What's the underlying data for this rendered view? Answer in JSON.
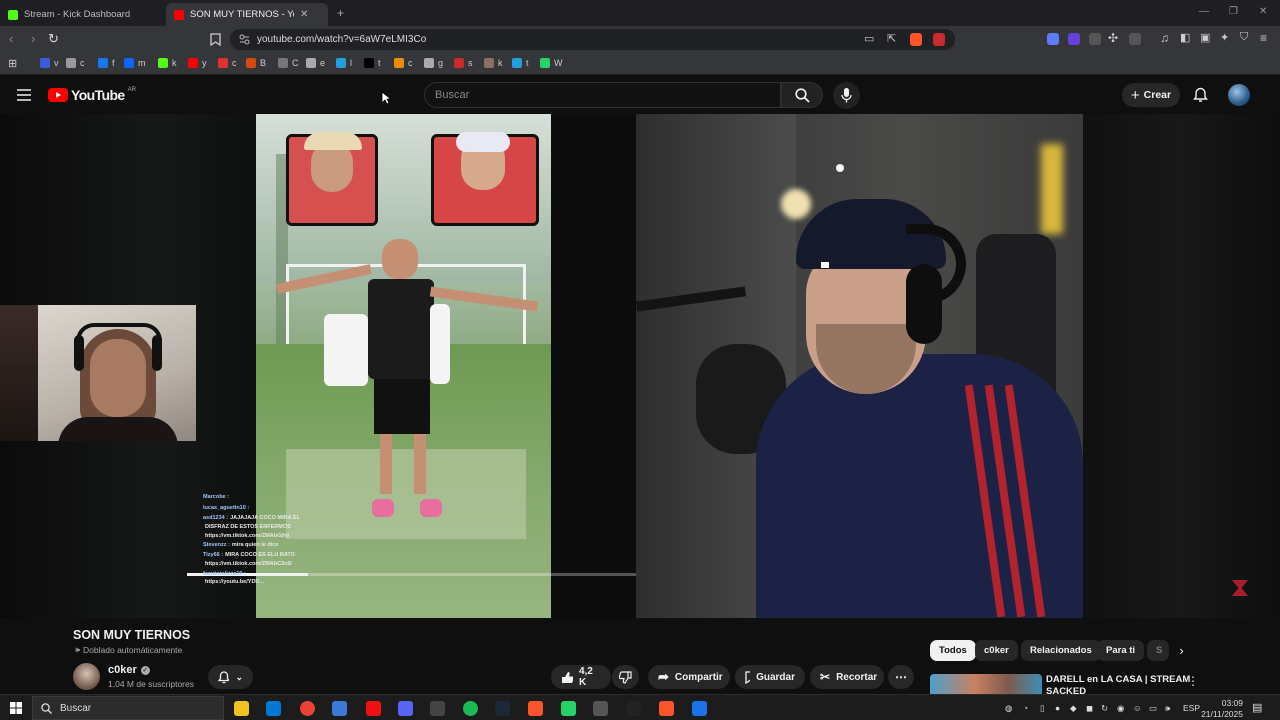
{
  "browser": {
    "tabs": [
      {
        "label": "Stream - Kick Dashboard",
        "favicon_color": "#53fc18"
      },
      {
        "label": "SON MUY TIERNOS - YouTub",
        "favicon_color": "#ff0000"
      }
    ],
    "new_tab_symbol": "+",
    "url": "youtube.com/watch?v=6aW7eLMI3Co",
    "bookmarks": [
      "v",
      "c",
      "f",
      "m",
      "k",
      "y",
      "c",
      "B",
      "C",
      "e",
      "l",
      "t",
      "c",
      "g",
      "s",
      "k",
      "t",
      "W"
    ],
    "bookmark_colors": [
      "#3b5bdb",
      "#999",
      "#1877f2",
      "#0a66ff",
      "#53fc18",
      "#ff0000",
      "#e03131",
      "#d9480f",
      "#777",
      "#aaa",
      "#229ed9",
      "#000",
      "#f08c00",
      "#aaa",
      "#c92a2a",
      "#8d6e63",
      "#229ed9",
      "#25d366"
    ]
  },
  "youtube": {
    "logo_text": "YouTube",
    "country": "AR",
    "search_placeholder": "Buscar",
    "create_label": "Crear"
  },
  "chat": [
    {
      "user": "Marcobe :",
      "msg": ""
    },
    {
      "user": "lucas_aguetin10 :",
      "msg": ""
    },
    {
      "user": "asd1234 :",
      "msg": "JAJAJAJA COCO MIRA EL"
    },
    {
      "user": "",
      "msg": "DISFRAZ DE ESTOS ENFERMOS"
    },
    {
      "user": "",
      "msg": "https://vm.tiktok.com/ZMAbGjhj/"
    },
    {
      "user": "Stevenzz :",
      "msg": "mira quien le dice"
    },
    {
      "user": "Tizy66 :",
      "msg": "MIRA COCO ES ELU RATO"
    },
    {
      "user": "",
      "msg": "https://vm.tiktok.com/ZMAbC3c6/"
    },
    {
      "user": "facutoralizza19 :",
      "msg": ""
    },
    {
      "user": "",
      "msg": "https://youtu.be/YDD..."
    }
  ],
  "video": {
    "title": "SON MUY TIERNOS",
    "dubbed_label": "Doblado automáticamente",
    "channel": "c0ker",
    "subscribers": "1,04 M de suscriptores",
    "likes": "4,2 K",
    "share_label": "Compartir",
    "save_label": "Guardar",
    "clip_label": "Recortar",
    "progress_fraction": 0.27
  },
  "filters": [
    "Todos",
    "c0ker",
    "Relacionados",
    "Para ti",
    "S"
  ],
  "related": {
    "title_line1": "DARELL en LA CASA | STREAM",
    "title_line2": "SACKED"
  },
  "taskbar": {
    "search_placeholder": "Buscar",
    "language": "ESP",
    "time": "03:09",
    "date": "21/11/2025",
    "apps": [
      "#f0c420",
      "#0078d4",
      "#ea4335",
      "#3c78d8",
      "#e11",
      "#5865f2",
      "#444",
      "#1db954",
      "#1b2838",
      "#fb542b",
      "#25d366",
      "#555",
      "#222",
      "#fb542b",
      "#1a73e8"
    ]
  }
}
